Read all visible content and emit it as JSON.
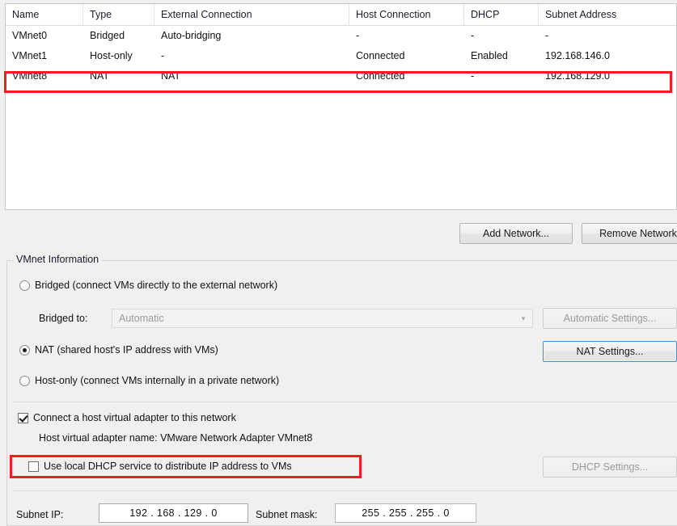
{
  "table": {
    "columns": [
      {
        "key": "name",
        "label": "Name"
      },
      {
        "key": "type",
        "label": "Type"
      },
      {
        "key": "extc",
        "label": "External Connection"
      },
      {
        "key": "hostc",
        "label": "Host Connection"
      },
      {
        "key": "dhcp",
        "label": "DHCP"
      },
      {
        "key": "subnet",
        "label": "Subnet Address"
      }
    ],
    "rows": [
      {
        "name": "VMnet0",
        "type": "Bridged",
        "extc": "Auto-bridging",
        "hostc": "-",
        "dhcp": "-",
        "subnet": "-",
        "highlighted": false
      },
      {
        "name": "VMnet1",
        "type": "Host-only",
        "extc": "-",
        "hostc": "Connected",
        "dhcp": "Enabled",
        "subnet": "192.168.146.0",
        "highlighted": false
      },
      {
        "name": "VMnet8",
        "type": "NAT",
        "extc": "NAT",
        "hostc": "Connected",
        "dhcp": "-",
        "subnet": "192.168.129.0",
        "highlighted": true
      }
    ]
  },
  "buttons": {
    "add_network": "Add Network...",
    "remove_network": "Remove Network",
    "automatic_settings": "Automatic Settings...",
    "nat_settings": "NAT Settings...",
    "dhcp_settings": "DHCP Settings..."
  },
  "vmnet_info": {
    "legend": "VMnet Information",
    "radio_bridged": "Bridged (connect VMs directly to the external network)",
    "radio_nat": "NAT (shared host's IP address with VMs)",
    "radio_hostonly": "Host-only (connect VMs internally in a private network)",
    "selected_radio": "nat",
    "bridged_to_label": "Bridged to:",
    "bridged_to_value": "Automatic",
    "bridged_to_arrow": "chevron-down-icon",
    "check_connect_adapter": "Connect a host virtual adapter to this network",
    "check_connect_adapter_checked": true,
    "host_adapter_name": "Host virtual adapter name: VMware Network Adapter VMnet8",
    "check_use_dhcp": "Use local DHCP service to distribute IP address to VMs",
    "check_use_dhcp_checked": false,
    "subnet_ip_label": "Subnet IP:",
    "subnet_ip_value": "192 . 168 . 129 .  0",
    "subnet_mask_label": "Subnet mask:",
    "subnet_mask_value": "255 . 255 . 255 .  0"
  },
  "colors": {
    "highlight_red": "#f41c1c",
    "focus_blue": "#3c8fd4",
    "window_background": "#f0f0f0",
    "table_background": "#ffffff",
    "disabled_text": "#9a9a9a"
  }
}
